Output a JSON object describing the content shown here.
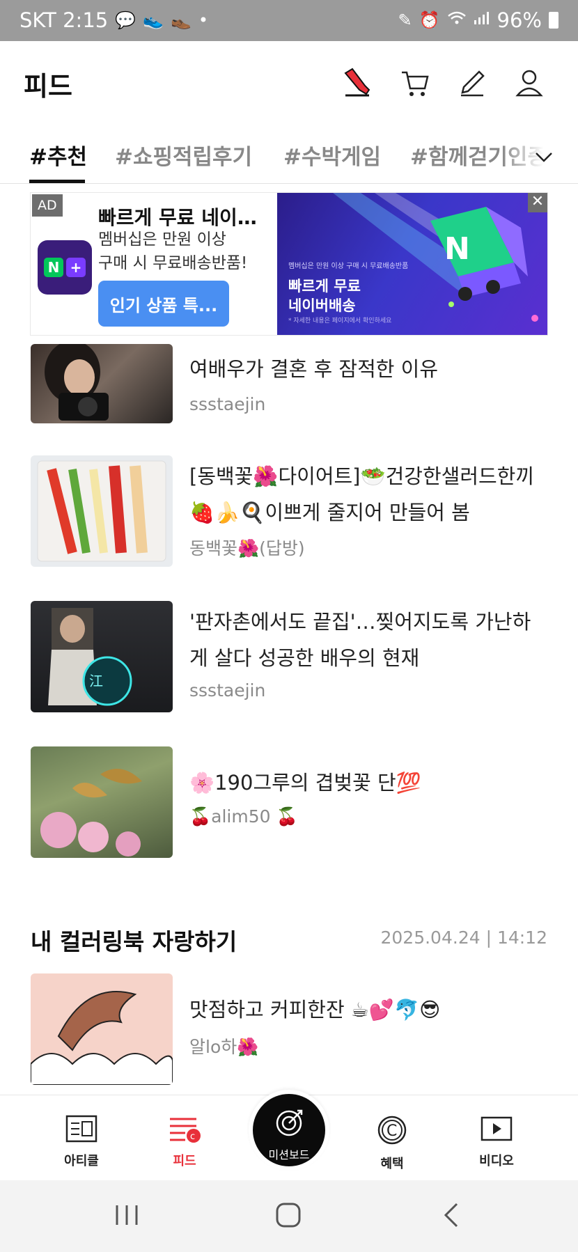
{
  "status_bar": {
    "carrier_time": "SKT 2:15",
    "talk_badge": "TALK",
    "battery": "96%"
  },
  "header": {
    "title": "피드",
    "icons": [
      "sneaker-icon",
      "cart-icon",
      "pencil-icon",
      "profile-icon"
    ]
  },
  "tabs": [
    {
      "label": "#추천",
      "active": true
    },
    {
      "label": "#쇼핑적립후기",
      "active": false
    },
    {
      "label": "#수박게임",
      "active": false
    },
    {
      "label": "#함께걷기인증",
      "active": false
    }
  ],
  "ad": {
    "badge": "AD",
    "title": "빠르게 무료 네이…",
    "desc_line1": "멤버십은 만원 이상",
    "desc_line2": "구매 시 무료배송반품!",
    "cta": "인기 상품 특...",
    "banner_small": "멤버십은 만원 이상 구매 시 무료배송반품",
    "banner_line1": "빠르게 무료",
    "banner_line2": "네이버배송",
    "banner_tiny": "* 자세한 내용은 페이지에서 확인하세요",
    "close": "✕",
    "logo_text": "N+"
  },
  "feed": [
    {
      "title": "여배우가 결혼 후 잠적한 이유",
      "author": "ssstaejin"
    },
    {
      "title": "[동백꽃🌺다이어트]🥗건강한샐러드한끼🍓🍌🍳이쁘게 줄지어 만들어 봄",
      "author": "동백꽃🌺(답방)"
    },
    {
      "title": "'판자촌에서도 끝집'…찢어지도록 가난하게 살다 성공한 배우의 현재",
      "author": "ssstaejin"
    },
    {
      "title": "🌸190그루의 겹벚꽃 단💯",
      "author": "🍒alim50 🍒"
    }
  ],
  "section": {
    "title": "내 컬러링북 자랑하기",
    "date": "2025.04.24 | 14:12",
    "item": {
      "title": "맛점하고 커피한잔 ☕💕🐬😎",
      "author": "알lo하🌺"
    }
  },
  "bottom_nav": [
    {
      "label": "아티클",
      "icon": "article-icon",
      "active": false
    },
    {
      "label": "피드",
      "icon": "feed-icon",
      "active": true
    },
    {
      "label": "미션보드",
      "icon": "mission-icon",
      "active": false
    },
    {
      "label": "혜택",
      "icon": "coin-icon",
      "active": false
    },
    {
      "label": "비디오",
      "icon": "video-icon",
      "active": false
    }
  ],
  "colors": {
    "accent_red": "#e8303a",
    "cta_blue": "#4a8ff2",
    "naver_green": "#03c75a"
  }
}
